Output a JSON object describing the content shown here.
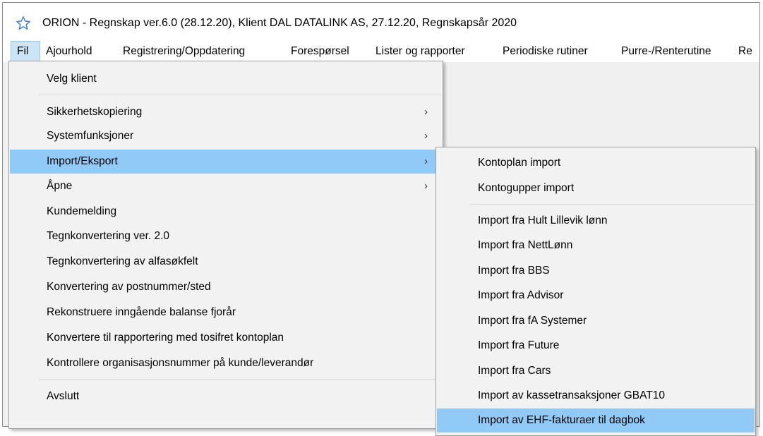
{
  "window": {
    "title": "ORION  -  Regnskap  ver.6.0 (28.12.20), Klient DAL DATALINK AS, 27.12.20, Regnskapsår 2020",
    "icon": "star-icon"
  },
  "menubar": {
    "items": [
      {
        "label": "Fil",
        "active": true
      },
      {
        "label": "Ajourhold"
      },
      {
        "label": "Registrering/Oppdatering"
      },
      {
        "label": "Forespørsel"
      },
      {
        "label": "Lister og rapporter"
      },
      {
        "label": "Periodiske rutiner"
      },
      {
        "label": "Purre-/Renterutine"
      },
      {
        "label": "Re"
      }
    ]
  },
  "file_menu": {
    "items": [
      {
        "label": "Velg klient"
      },
      {
        "label": "Sikkerhetskopiering",
        "arrow": "›"
      },
      {
        "label": "Systemfunksjoner",
        "arrow": "›"
      },
      {
        "label": "Import/Eksport",
        "arrow": "›",
        "highlighted": true
      },
      {
        "label": "Åpne",
        "arrow": "›"
      },
      {
        "label": "Kundemelding"
      },
      {
        "label": "Tegnkonvertering ver. 2.0"
      },
      {
        "label": "Tegnkonvertering av alfasøkfelt"
      },
      {
        "label": "Konvertering av postnummer/sted"
      },
      {
        "label": "Rekonstruere inngående balanse fjorår"
      },
      {
        "label": "Konvertere til rapportering med tosifret kontoplan"
      },
      {
        "label": "Kontrollere organisasjonsnummer på kunde/leverandør"
      },
      {
        "label": "Avslutt"
      }
    ]
  },
  "import_export_submenu": {
    "items": [
      {
        "label": "Kontoplan import"
      },
      {
        "label": "Kontogupper import"
      },
      {
        "label": "Import fra Hult  Lillevik lønn"
      },
      {
        "label": "Import fra NettLønn"
      },
      {
        "label": "Import fra BBS"
      },
      {
        "label": "Import fra Advisor"
      },
      {
        "label": "Import fra fA Systemer"
      },
      {
        "label": "Import fra Future"
      },
      {
        "label": "Import fra Cars"
      },
      {
        "label": "Import av kassetransaksjoner GBAT10"
      },
      {
        "label": "Import av EHF-fakturaer til dagbok",
        "highlighted": true
      }
    ]
  },
  "colors": {
    "highlight": "#91c9f7",
    "menu_background": "#f2f2f2",
    "icon_star": "#3f7fd0"
  }
}
